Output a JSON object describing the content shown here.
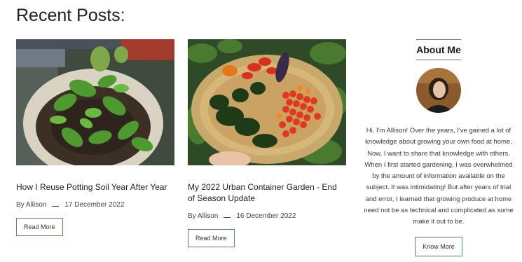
{
  "section": {
    "title": "Recent Posts:"
  },
  "posts": [
    {
      "title": "How I Reuse Potting Soil Year After Year",
      "author": "By Allison",
      "date": "17 December 2022",
      "read_more": "Read More",
      "image_alt": "potted pepper plant seedling"
    },
    {
      "title": "My 2022 Urban Container Garden - End of Season Update",
      "author": "By Allison",
      "date": "16 December 2022",
      "read_more": "Read More",
      "image_alt": "basket of harvested peppers and tomatoes"
    }
  ],
  "sidebar": {
    "title": "About Me",
    "text": "Hi, I'm Allison! Over the years, I've gained a lot of knowledge about growing your own food at home. Now, I want to share that knowledge with others. When I first started gardening, I was overwhelmed by the amount of information available on the subject. It was intimidating! But after years of trial and error, I learned that growing produce at home need not be as technical and complicated as some make it out to be.",
    "button": "Know More"
  },
  "colors": {
    "accent_border": "#5a8a5a",
    "text": "#222222"
  }
}
